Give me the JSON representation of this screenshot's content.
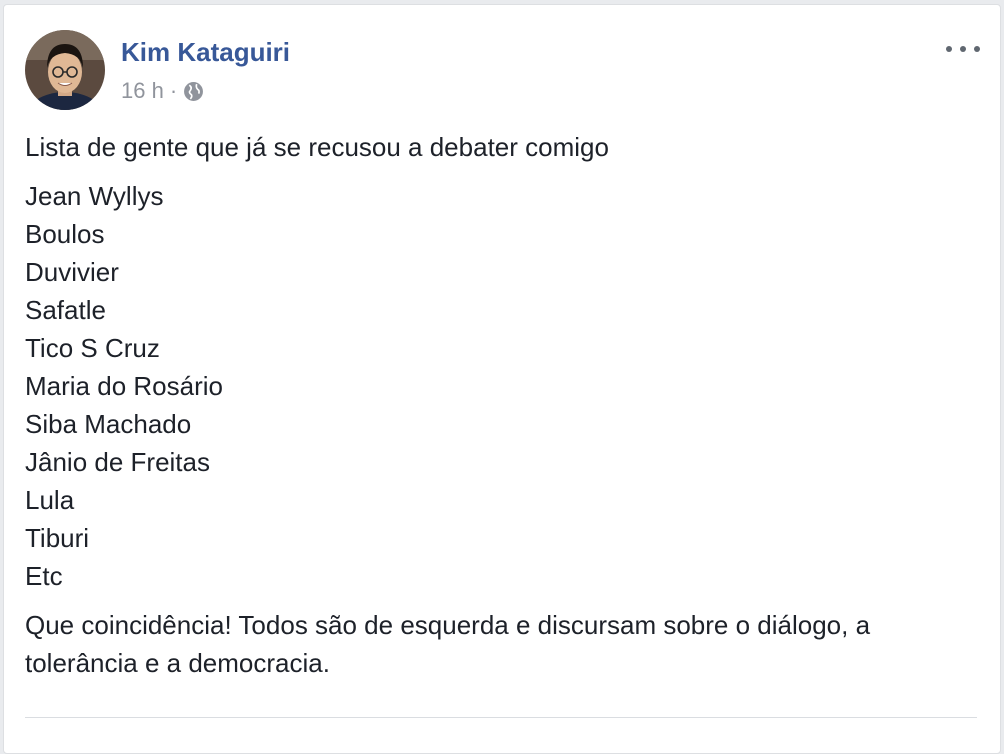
{
  "post": {
    "author": "Kim Kataguiri",
    "time": "16 h",
    "separator": "·",
    "privacy_icon": "globe-icon",
    "more_icon": "ellipsis-icon",
    "intro": "Lista de gente que já se recusou a debater comigo",
    "names": [
      "Jean Wyllys",
      "Boulos",
      "Duvivier",
      "Safatle",
      "Tico S Cruz",
      "Maria do Rosário",
      "Siba Machado",
      "Jânio de Freitas",
      "Lula",
      "Tiburi",
      "Etc"
    ],
    "conclusion": "Que coincidência! Todos são de esquerda e discursam sobre o diálogo, a tolerância e a democracia."
  },
  "colors": {
    "author_name": "#385898",
    "meta_text": "#90949c",
    "body_text": "#1d2129"
  }
}
